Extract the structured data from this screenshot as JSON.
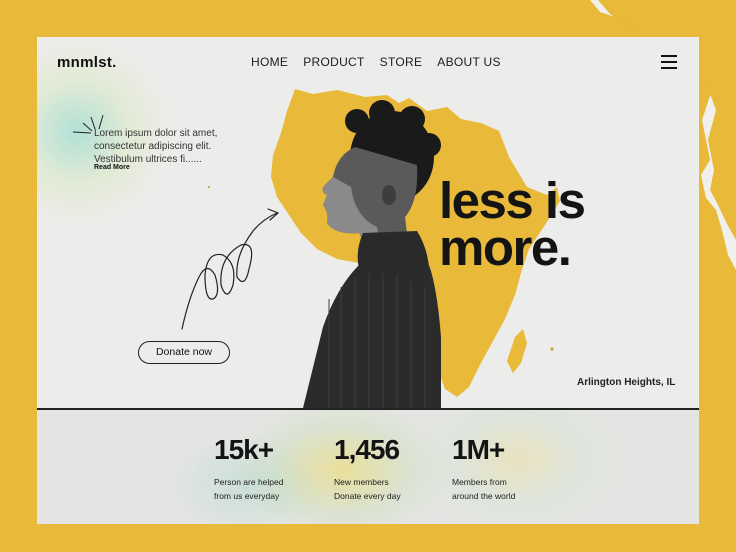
{
  "header": {
    "brand": "mnmlst.",
    "nav": [
      "HOME",
      "PRODUCT",
      "STORE",
      "ABOUT US"
    ]
  },
  "hero": {
    "lorem_lines": [
      "Lorem ipsum dolor sit amet,",
      "consectetur adipiscing elit.",
      "Vestibulum ultrices fi......"
    ],
    "read_more": "Read More",
    "donate_label": "Donate now",
    "headline_line1": "less is",
    "headline_line2": "more.",
    "location": "Arlington Heights, IL"
  },
  "stats": [
    {
      "value": "15k+",
      "line1": "Person are helped",
      "line2": "from us everyday"
    },
    {
      "value": "1,456",
      "line1": "New members",
      "line2": "Donate every day"
    },
    {
      "value": "1M+",
      "line1": "Members from",
      "line2": "around the world"
    }
  ],
  "colors": {
    "accent": "#e9b93a",
    "page": "#ececea",
    "text": "#141414"
  },
  "icons": [
    "hamburger-menu-icon",
    "sparkle-icon",
    "curly-arrow-icon"
  ]
}
